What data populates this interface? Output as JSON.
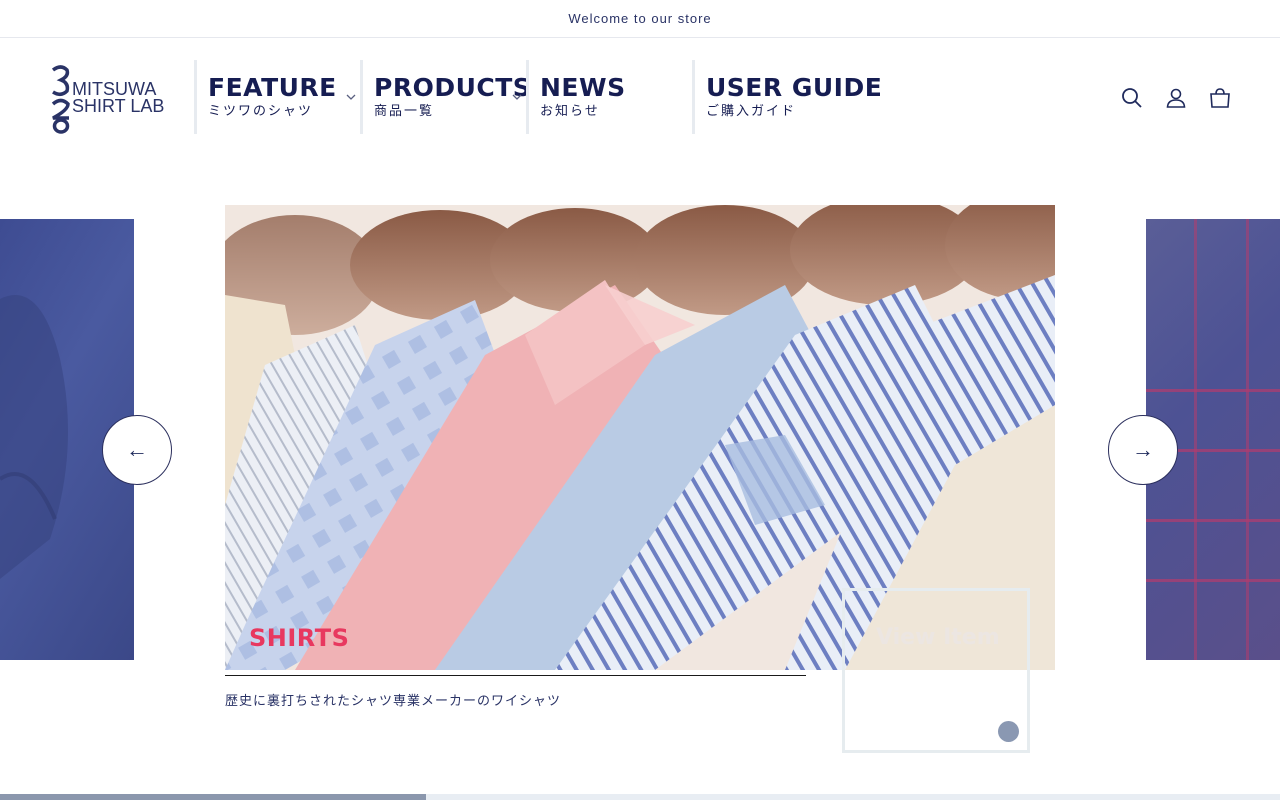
{
  "announcement": {
    "text": "Welcome to our store"
  },
  "logo": {
    "line1": "MITSUWA",
    "line2": "SHIRT LAB",
    "mark": "320"
  },
  "nav": {
    "items": [
      {
        "en": "FEATURE",
        "jp": "ミツワのシャツ",
        "has_dropdown": true
      },
      {
        "en": "PRODUCTS",
        "jp": "商品一覧",
        "has_dropdown": true
      },
      {
        "en": "NEWS",
        "jp": "お知らせ",
        "has_dropdown": false
      },
      {
        "en": "USER GUIDE",
        "jp": "ご購入ガイド",
        "has_dropdown": false
      }
    ]
  },
  "header_icons": [
    "search-icon",
    "account-icon",
    "cart-icon"
  ],
  "slider": {
    "title": "SHIRTS",
    "description": "歴史に裏打ちされたシャツ専業メーカーのワイシャツ",
    "view_label": "View Item",
    "prev_arrow": "←",
    "next_arrow": "→",
    "progress": 0.333
  },
  "colors": {
    "accent": "#e8385f",
    "navy": "#161d52",
    "progress": "#8b97ad"
  }
}
